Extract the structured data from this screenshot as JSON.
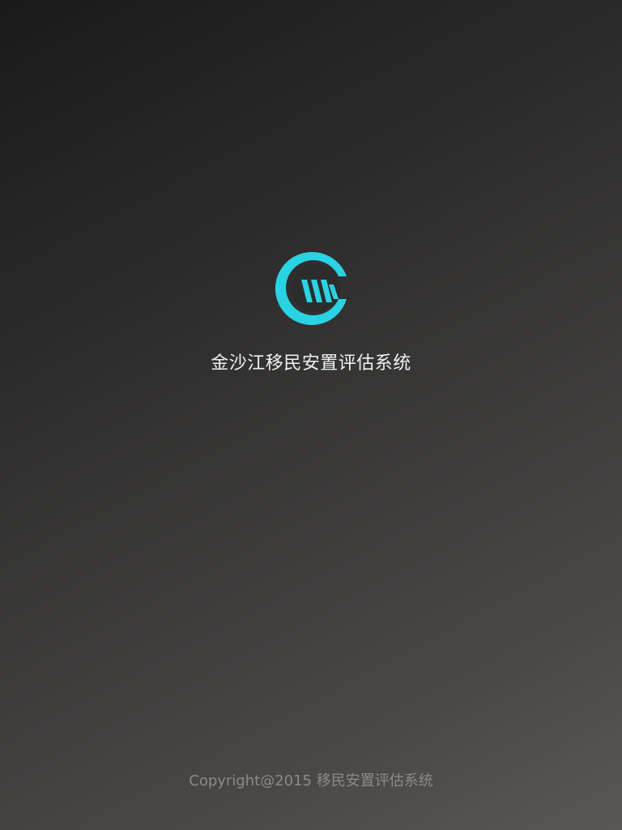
{
  "splash": {
    "logo_icon": "jinsha-river-logo-icon",
    "title": "金沙江移民安置评估系统",
    "copyright": "Copyright@2015 移民安置评估系统"
  },
  "colors": {
    "accent": "#29d3e3",
    "background_top": "#1a1a1a",
    "background_bottom": "#5a5655",
    "title_text": "#f2f2f2",
    "copyright_text": "#8c8a89"
  }
}
